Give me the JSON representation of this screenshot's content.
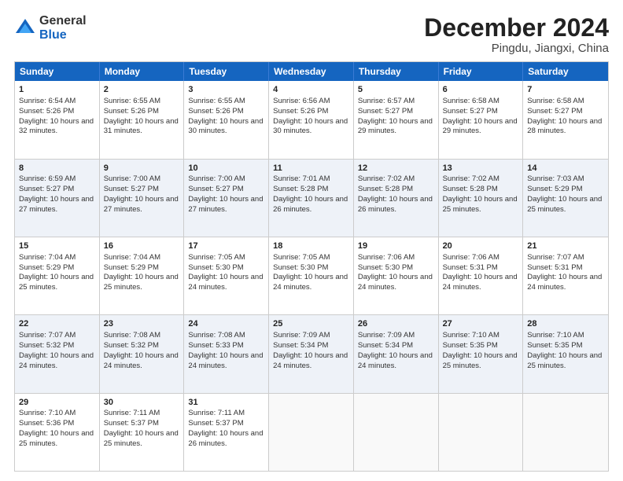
{
  "logo": {
    "general": "General",
    "blue": "Blue"
  },
  "title": "December 2024",
  "subtitle": "Pingdu, Jiangxi, China",
  "days": [
    "Sunday",
    "Monday",
    "Tuesday",
    "Wednesday",
    "Thursday",
    "Friday",
    "Saturday"
  ],
  "weeks": [
    [
      {
        "day": "1",
        "sunrise": "6:54 AM",
        "sunset": "5:26 PM",
        "daylight": "10 hours and 32 minutes."
      },
      {
        "day": "2",
        "sunrise": "6:55 AM",
        "sunset": "5:26 PM",
        "daylight": "10 hours and 31 minutes."
      },
      {
        "day": "3",
        "sunrise": "6:55 AM",
        "sunset": "5:26 PM",
        "daylight": "10 hours and 30 minutes."
      },
      {
        "day": "4",
        "sunrise": "6:56 AM",
        "sunset": "5:26 PM",
        "daylight": "10 hours and 30 minutes."
      },
      {
        "day": "5",
        "sunrise": "6:57 AM",
        "sunset": "5:27 PM",
        "daylight": "10 hours and 29 minutes."
      },
      {
        "day": "6",
        "sunrise": "6:58 AM",
        "sunset": "5:27 PM",
        "daylight": "10 hours and 29 minutes."
      },
      {
        "day": "7",
        "sunrise": "6:58 AM",
        "sunset": "5:27 PM",
        "daylight": "10 hours and 28 minutes."
      }
    ],
    [
      {
        "day": "8",
        "sunrise": "6:59 AM",
        "sunset": "5:27 PM",
        "daylight": "10 hours and 27 minutes."
      },
      {
        "day": "9",
        "sunrise": "7:00 AM",
        "sunset": "5:27 PM",
        "daylight": "10 hours and 27 minutes."
      },
      {
        "day": "10",
        "sunrise": "7:00 AM",
        "sunset": "5:27 PM",
        "daylight": "10 hours and 27 minutes."
      },
      {
        "day": "11",
        "sunrise": "7:01 AM",
        "sunset": "5:28 PM",
        "daylight": "10 hours and 26 minutes."
      },
      {
        "day": "12",
        "sunrise": "7:02 AM",
        "sunset": "5:28 PM",
        "daylight": "10 hours and 26 minutes."
      },
      {
        "day": "13",
        "sunrise": "7:02 AM",
        "sunset": "5:28 PM",
        "daylight": "10 hours and 25 minutes."
      },
      {
        "day": "14",
        "sunrise": "7:03 AM",
        "sunset": "5:29 PM",
        "daylight": "10 hours and 25 minutes."
      }
    ],
    [
      {
        "day": "15",
        "sunrise": "7:04 AM",
        "sunset": "5:29 PM",
        "daylight": "10 hours and 25 minutes."
      },
      {
        "day": "16",
        "sunrise": "7:04 AM",
        "sunset": "5:29 PM",
        "daylight": "10 hours and 25 minutes."
      },
      {
        "day": "17",
        "sunrise": "7:05 AM",
        "sunset": "5:30 PM",
        "daylight": "10 hours and 24 minutes."
      },
      {
        "day": "18",
        "sunrise": "7:05 AM",
        "sunset": "5:30 PM",
        "daylight": "10 hours and 24 minutes."
      },
      {
        "day": "19",
        "sunrise": "7:06 AM",
        "sunset": "5:30 PM",
        "daylight": "10 hours and 24 minutes."
      },
      {
        "day": "20",
        "sunrise": "7:06 AM",
        "sunset": "5:31 PM",
        "daylight": "10 hours and 24 minutes."
      },
      {
        "day": "21",
        "sunrise": "7:07 AM",
        "sunset": "5:31 PM",
        "daylight": "10 hours and 24 minutes."
      }
    ],
    [
      {
        "day": "22",
        "sunrise": "7:07 AM",
        "sunset": "5:32 PM",
        "daylight": "10 hours and 24 minutes."
      },
      {
        "day": "23",
        "sunrise": "7:08 AM",
        "sunset": "5:32 PM",
        "daylight": "10 hours and 24 minutes."
      },
      {
        "day": "24",
        "sunrise": "7:08 AM",
        "sunset": "5:33 PM",
        "daylight": "10 hours and 24 minutes."
      },
      {
        "day": "25",
        "sunrise": "7:09 AM",
        "sunset": "5:34 PM",
        "daylight": "10 hours and 24 minutes."
      },
      {
        "day": "26",
        "sunrise": "7:09 AM",
        "sunset": "5:34 PM",
        "daylight": "10 hours and 24 minutes."
      },
      {
        "day": "27",
        "sunrise": "7:10 AM",
        "sunset": "5:35 PM",
        "daylight": "10 hours and 25 minutes."
      },
      {
        "day": "28",
        "sunrise": "7:10 AM",
        "sunset": "5:35 PM",
        "daylight": "10 hours and 25 minutes."
      }
    ],
    [
      {
        "day": "29",
        "sunrise": "7:10 AM",
        "sunset": "5:36 PM",
        "daylight": "10 hours and 25 minutes."
      },
      {
        "day": "30",
        "sunrise": "7:11 AM",
        "sunset": "5:37 PM",
        "daylight": "10 hours and 25 minutes."
      },
      {
        "day": "31",
        "sunrise": "7:11 AM",
        "sunset": "5:37 PM",
        "daylight": "10 hours and 26 minutes."
      },
      {
        "day": "",
        "sunrise": "",
        "sunset": "",
        "daylight": ""
      },
      {
        "day": "",
        "sunrise": "",
        "sunset": "",
        "daylight": ""
      },
      {
        "day": "",
        "sunrise": "",
        "sunset": "",
        "daylight": ""
      },
      {
        "day": "",
        "sunrise": "",
        "sunset": "",
        "daylight": ""
      }
    ]
  ]
}
